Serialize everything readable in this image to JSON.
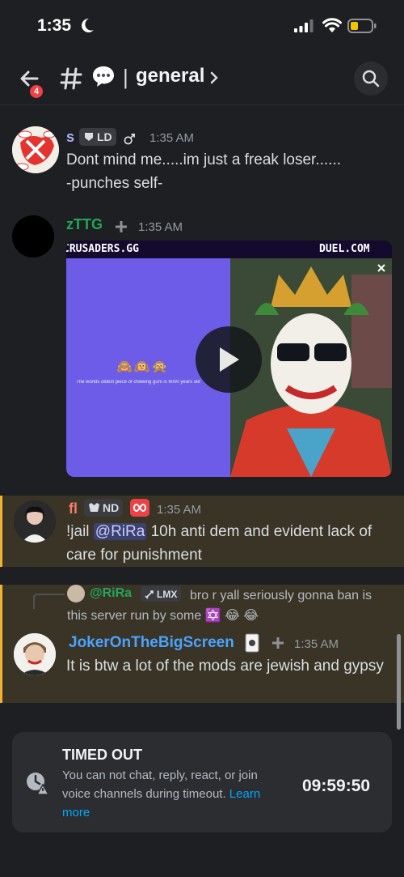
{
  "status_bar": {
    "time": "1:35"
  },
  "header": {
    "badge_count": "4",
    "channel": "general"
  },
  "messages": [
    {
      "username": "s",
      "tag": "LD",
      "time": "1:35 AM",
      "text": "Dont mind me.....im just a freak loser......\n-punches self-"
    },
    {
      "username": "zTTG",
      "time": "1:35 AM"
    },
    {
      "username": "fl",
      "tag": "ND",
      "time": "1:35 AM",
      "text_prefix": "!jail ",
      "mention": "@RiRa",
      "text_suffix": " 10h anti dem and evident lack of care for punishment"
    },
    {
      "reply_user": "@RiRa",
      "reply_tag": "LMX",
      "reply_text": "bro r yall seriously gonna ban is this server run by some",
      "username": "JokerOnTheBigScreen",
      "time": "1:35 AM",
      "text": "It is btw a lot of the mods are jewish and gypsy"
    }
  ],
  "video": {
    "left_caption": "CRUSADERS.GG",
    "right_caption": "DUEL.COM",
    "inner_text": "The worlds oldest piece of chewing gum is 9000 years old"
  },
  "timeout": {
    "title": "TIMED OUT",
    "desc": "You can not chat, reply, react, or join voice channels during timeout.",
    "link": "Learn more",
    "timer": "09:59:50"
  },
  "colors": {
    "background": "#1e1f22",
    "highlight": "#3a3426",
    "highlight_border": "#f0b232",
    "zttg": "#23a55a",
    "fl": "#f57b6b",
    "joker": "#4aa3ff",
    "link": "#00a8fc"
  }
}
